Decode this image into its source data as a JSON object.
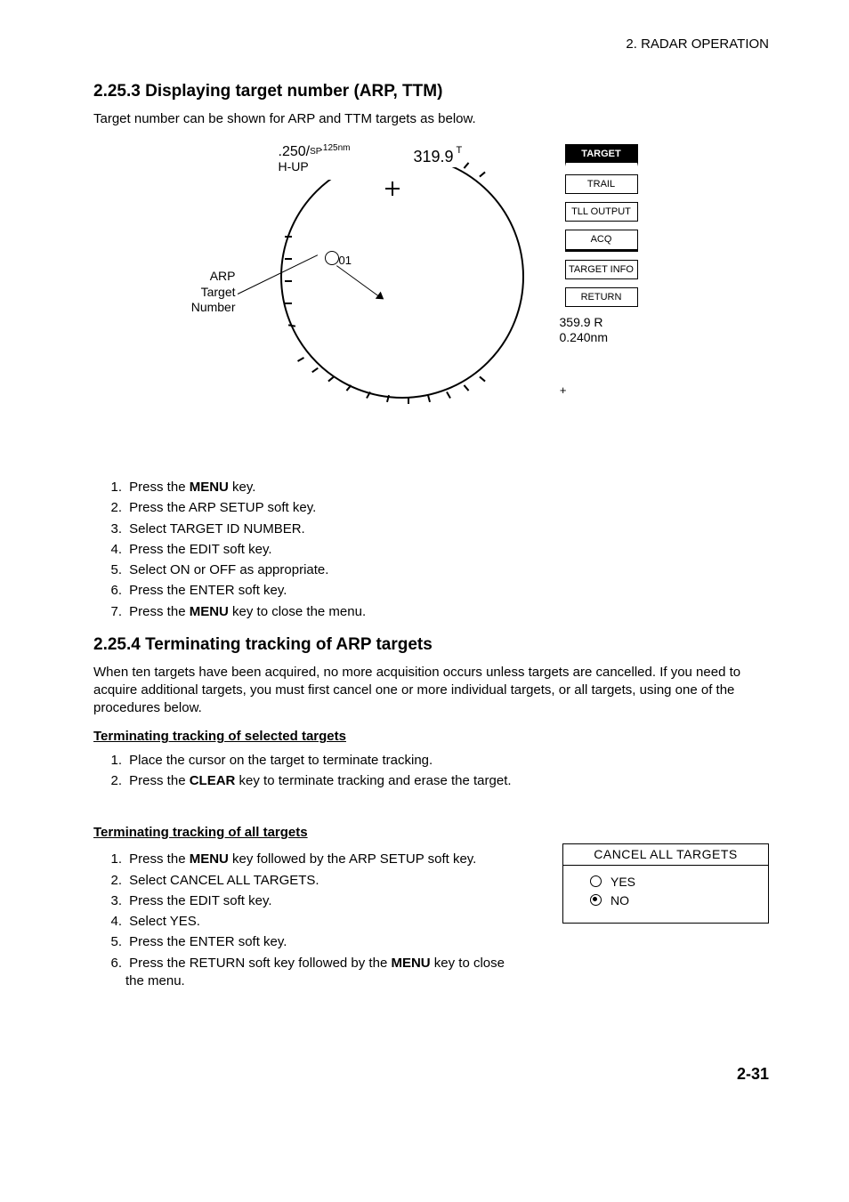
{
  "header": {
    "right": "2. RADAR OPERATION"
  },
  "section1": {
    "title": "2.25.3  Displaying target number (ARP, TTM)",
    "intro": "Target number can be shown for ARP and TTM targets as below.",
    "figure": {
      "left_label_l1": "ARP",
      "left_label_l2": "Target",
      "left_label_l3": "Number",
      "range": ".250/",
      "sp": "SP",
      "nm": ".125nm",
      "mode": "H-UP",
      "heading": "319.9",
      "heading_suffix": "T",
      "echo_num": "01",
      "softkeys": [
        "TARGET",
        "TRAIL",
        "TLL OUTPUT",
        "ACQ",
        "TARGET INFO",
        "RETURN"
      ],
      "readout_brg": "359.9 R",
      "readout_rng": "0.240nm",
      "readout_plus": "+"
    },
    "steps": [
      {
        "n": "1.",
        "pre": "Press the ",
        "bold": "MENU",
        "post": " key."
      },
      {
        "n": "2.",
        "text": "Press the ARP SETUP soft key."
      },
      {
        "n": "3.",
        "text": "Select TARGET ID NUMBER."
      },
      {
        "n": "4.",
        "text": "Press the EDIT soft key."
      },
      {
        "n": "5.",
        "text": "Select ON or OFF as appropriate."
      },
      {
        "n": "6.",
        "text": "Press the ENTER soft key."
      },
      {
        "n": "7.",
        "pre": "Press the ",
        "bold": "MENU",
        "post": " key to close the menu."
      }
    ]
  },
  "section2": {
    "title": "2.25.4  Terminating tracking of ARP targets",
    "intro": "When ten targets have been acquired, no more acquisition occurs unless targets are cancelled. If you need to acquire additional targets, you must first cancel one or more individual targets, or all targets, using one of the procedures below.",
    "sub1": {
      "title": "Terminating tracking of selected targets",
      "steps": [
        {
          "n": "1.",
          "text": "Place the cursor on the target to terminate tracking."
        },
        {
          "n": "2.",
          "pre": "Press the ",
          "bold": "CLEAR",
          "post": " key to terminate tracking and erase the target."
        }
      ]
    },
    "sub2": {
      "title": "Terminating tracking of all targets",
      "steps": [
        {
          "n": "1.",
          "pre": "Press the ",
          "bold": "MENU",
          "post": " key followed by the ARP SETUP soft key."
        },
        {
          "n": "2.",
          "text": "Select CANCEL ALL TARGETS."
        },
        {
          "n": "3.",
          "text": "Press the EDIT soft key."
        },
        {
          "n": "4.",
          "text": "Select YES."
        },
        {
          "n": "5.",
          "text": "Press the ENTER soft key."
        },
        {
          "n": "6.",
          "pre": "Press the RETURN soft key followed by the ",
          "bold": "MENU",
          "post": " key to close the menu."
        }
      ],
      "box": {
        "title": "CANCEL ALL TARGETS",
        "opt_yes": "YES",
        "opt_no": "NO"
      }
    }
  },
  "page_number": "2-31"
}
